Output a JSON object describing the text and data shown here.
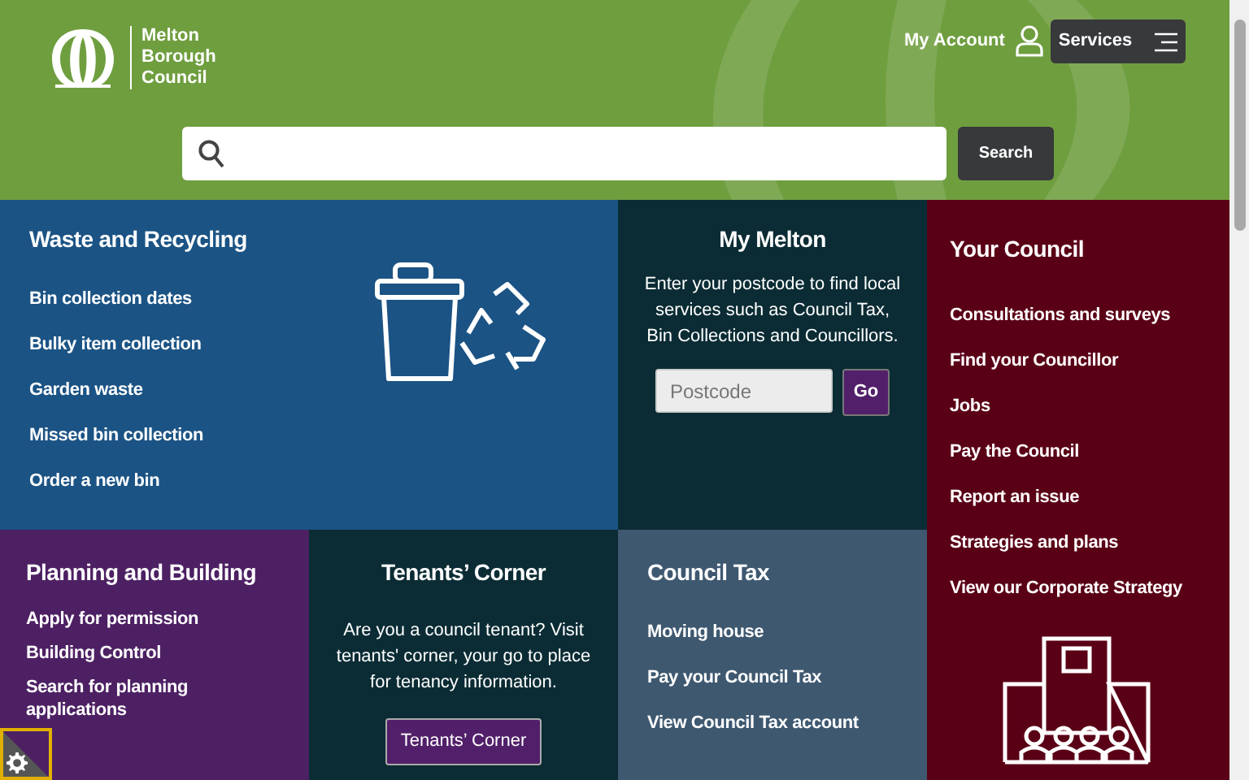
{
  "header": {
    "logo_lines": [
      "Melton",
      "Borough",
      "Council"
    ],
    "account_link": "My Account",
    "services_button": "Services"
  },
  "search": {
    "button": "Search"
  },
  "tiles": [
    {
      "kind": "links",
      "title": "Waste and Recycling",
      "links": [
        "Bin collection dates",
        "Bulky item collection",
        "Garden waste",
        "Missed bin collection",
        "Order a new bin"
      ]
    },
    {
      "kind": "postcode",
      "title": "My Melton",
      "text": "Enter your postcode to find local services such as Council Tax, Bin Collections and Councillors.",
      "placeholder": "Postcode",
      "button": "Go"
    },
    {
      "kind": "links",
      "title": "Your Council",
      "links": [
        "Consultations and surveys",
        "Find your Councillor",
        "Jobs",
        "Pay the Council",
        "Report an issue",
        "Strategies and plans",
        "View our Corporate Strategy"
      ]
    },
    {
      "kind": "links",
      "title": "Planning and Building",
      "links": [
        "Apply for permission",
        "Building Control",
        "Search for planning applications"
      ]
    },
    {
      "kind": "text_button",
      "title": "Tenants’ Corner",
      "text": "Are you a council tenant? Visit tenants' corner, your go to place for tenancy information.",
      "button": "Tenants’ Corner"
    },
    {
      "kind": "links",
      "title": "Council Tax",
      "links": [
        "Moving house",
        "Pay your Council Tax",
        "View Council Tax account"
      ]
    }
  ]
}
